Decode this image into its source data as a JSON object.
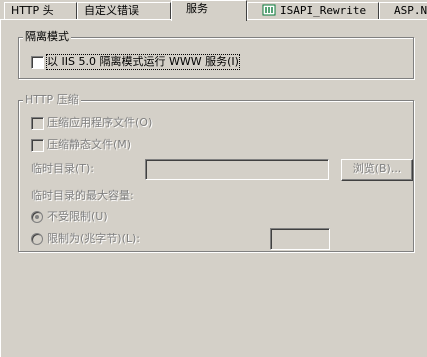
{
  "tabs": [
    {
      "label": "HTTP 头"
    },
    {
      "label": "自定义错误"
    },
    {
      "label": "服务",
      "active": true
    },
    {
      "label": "ISAPI_Rewrite",
      "icon": "isapi-rewrite-icon"
    },
    {
      "label": "ASP.N"
    }
  ],
  "isolation": {
    "title": "隔离模式",
    "checkbox_label": "以 IIS 5.0 隔离模式运行 WWW 服务(I)",
    "checked": false
  },
  "compression": {
    "title": "HTTP 压缩",
    "compress_app_files": "压缩应用程序文件(O)",
    "compress_static_files": "压缩静态文件(M)",
    "temp_dir_label": "临时目录(T):",
    "temp_dir_value": "",
    "browse_button": "浏览(B)...",
    "max_size_label": "临时目录的最大容量:",
    "unlimited_label": "不受限制(U)",
    "limit_label": "限制为(兆字节)(L):",
    "limit_value": "",
    "selected_option": "unlimited"
  },
  "colors": {
    "face": "#d4d0c8",
    "shadow": "#808080",
    "highlight": "#ffffff",
    "disabled_text": "#808080",
    "isapi_icon": "#0a7a3a"
  }
}
